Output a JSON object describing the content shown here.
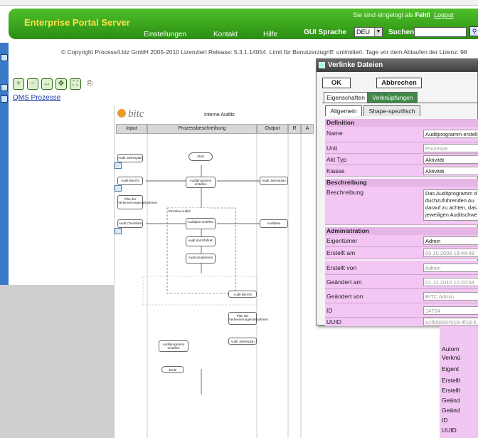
{
  "header": {
    "brand": "Enterprise Portal Server",
    "logged_prefix": "Sie sind eingelogt als",
    "logged_user": "Fehli",
    "logout": "Logout",
    "nav": [
      "Einstellungen",
      "Kontakt",
      "Hilfe"
    ],
    "lang_label": "GUI Sprache",
    "lang_value": "DEU",
    "search_label": "Suchen"
  },
  "copyright": "© Copyright Process4.biz GmbH 2005-2010 Lizenziert Release: 5.3.1.14054. Limit für Benutzerzugriff: unlimitiert. Tage vor dem Ablaufen der Lizenz: 98",
  "breadcrumb": "QMS Prozesse",
  "diagram": {
    "logo": "bitc",
    "title": "Interne Audits",
    "columns": [
      "Input",
      "Prozessbeschreibung",
      "Output",
      "R",
      "A"
    ],
    "boxes": {
      "start": "Start",
      "ende": "Ende",
      "b1": "Auditprogramm erstellen",
      "b2": "Auditplan erstellen",
      "b3": "Audit durchführen",
      "b4": "Audit analysieren",
      "group": "Einzelne Audits",
      "in1": "Audit Jahresplan",
      "in2": "Audit Bericht",
      "in3": "Plan der Verbesserungsmaßnahmen",
      "in4": "Audit Checkliste",
      "out1": "Audit Jahresplan",
      "out2": "Auditplan",
      "out3": "Audit Bericht",
      "out4": "Plan der Verbesserungsmaßnahmen",
      "out5": "Audit Jahresplan"
    }
  },
  "dialog": {
    "title": "Verlinke Dateien",
    "ok": "OK",
    "cancel": "Abbrechen",
    "tabs": [
      "Eigenschaften",
      "Verknüpfungen"
    ],
    "subtabs": [
      "Allgemein",
      "Shape-spezifisch"
    ],
    "sections": {
      "definition": "Definition",
      "beschreibung": "Beschreibung",
      "administration": "Administration"
    },
    "fields": {
      "name": {
        "label": "Name",
        "value": "Auditprogramm erstellen"
      },
      "unit": {
        "label": "Unit",
        "value": "Prozesse"
      },
      "akt_typ": {
        "label": "Akt Typ",
        "value": "Aktivität"
      },
      "klasse": {
        "label": "Klasse",
        "value": "Aktivität"
      },
      "beschreibung": {
        "label": "Beschreibung",
        "lines": [
          "Das Auditprogramm d",
          "duchzuführenden Au",
          "darauf zu achten, das",
          "jeweiligen Auditschwe"
        ]
      },
      "eigentuemer": {
        "label": "Eigentümer",
        "value": "Admin"
      },
      "erstellt_am": {
        "label": "Erstellt am",
        "value": "09.10.2009 19:46:49"
      },
      "erstellt_von": {
        "label": "Erstellt von",
        "value": "Admin"
      },
      "geaendert_am": {
        "label": "Geändert am",
        "value": "01.12.2010 12:20:54"
      },
      "geaendert_von": {
        "label": "Geändert von",
        "value": "BITC Admin"
      },
      "id": {
        "label": "ID",
        "value": "14724"
      },
      "uuid": {
        "label": "UUID",
        "value": "a1f9566d-fc18-4f18-b"
      }
    }
  },
  "under_panel": [
    "Autom",
    "Verknü",
    "Eigent",
    "Erstellt",
    "Erstellt",
    "Geänd",
    "Geänd",
    "ID",
    "UUID"
  ],
  "colors": {
    "brand": "#ffe24a",
    "header_green": "#2a8f12",
    "field_pink": "#f4c6f4",
    "link": "#1a3ea8"
  }
}
